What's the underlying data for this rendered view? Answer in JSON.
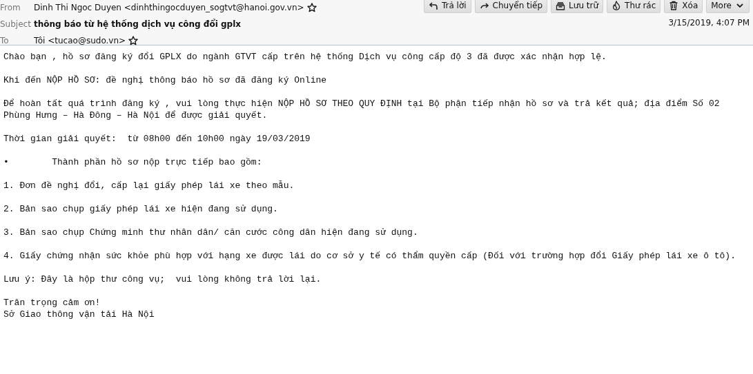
{
  "header": {
    "fields": [
      {
        "label": "From",
        "value": "Dinh Thi Ngoc Duyen <dinhthingocduyen_sogtvt@hanoi.gov.vn>",
        "kind": "address",
        "starred": false
      },
      {
        "label": "Subject",
        "value": "thông báo từ hệ thống dịch vụ công đổi gplx",
        "kind": "subject"
      },
      {
        "label": "To",
        "value": "Tôi <tucao@sudo.vn>",
        "kind": "address",
        "starred": false
      }
    ],
    "buttons": [
      {
        "label": "Trả lời",
        "kind": "reply"
      },
      {
        "label": "Chuyển tiếp",
        "kind": "forward"
      },
      {
        "label": "Lưu trữ",
        "kind": "archive"
      },
      {
        "label": "Thư rác",
        "kind": "junk"
      },
      {
        "label": "Xóa",
        "kind": "delete"
      },
      {
        "label": "More",
        "kind": "more"
      }
    ],
    "date": "3/15/2019, 4:07 PM"
  },
  "body": [
    {
      "text": "Chào bạn , hồ sơ đăng ký đổi GPLX do ngành GTVT cấp trên hệ thống Dịch vụ công cấp độ 3 đã được xác nhận hợp lệ.",
      "kind": "normal"
    },
    {
      "text": "Khi đến NỘP HỒ SƠ: đề nghị thông báo hồ sơ đã đăng ký Online",
      "kind": "normal"
    },
    {
      "text": "Để hoàn tất quá trình đăng ký , vui lòng thực hiện NỘP HỒ SƠ THEO QUY ĐỊNH tại Bộ phận tiếp nhận hồ sơ và trả kết quả; địa điểm Số 02 Phùng Hưng – Hà Đông – Hà Nội để được giải quyết.",
      "kind": "after-gap"
    },
    {
      "text": "Thời gian giải quyết:  từ 08h00 đến 10h00 ngày 19/03/2019",
      "kind": "normal"
    },
    {
      "text": "•\tThành phần hồ sơ nộp trực tiếp bao gồm:",
      "kind": "normal"
    },
    {
      "text": "1. Đơn đề nghị đổi, cấp lại giấy phép lái xe theo mẫu.",
      "kind": "normal"
    },
    {
      "text": "2. Bản sao chụp giấy phép lái xe hiện đang sử dụng.",
      "kind": "normal"
    },
    {
      "text": "3. Bản sao chụp Chứng minh thư nhân dân/ căn cước công dân hiện đang sử dụng.",
      "kind": "normal"
    },
    {
      "text": "4. Giấy chứng nhận sức khỏe phù hợp với hạng xe được lái do cơ sở y tế có thẩm quyền cấp (Đối với trường hợp đổi Giấy phép lái xe ô tô).",
      "kind": "normal"
    },
    {
      "text": "Lưu ý: Đây là hộp thư công vụ;  vui lòng không trả lời lại.",
      "kind": "after-gap"
    },
    {
      "text": "Trân trọng cảm ơn!\nSở Giao thông vận tải Hà Nội",
      "kind": "normal"
    }
  ]
}
